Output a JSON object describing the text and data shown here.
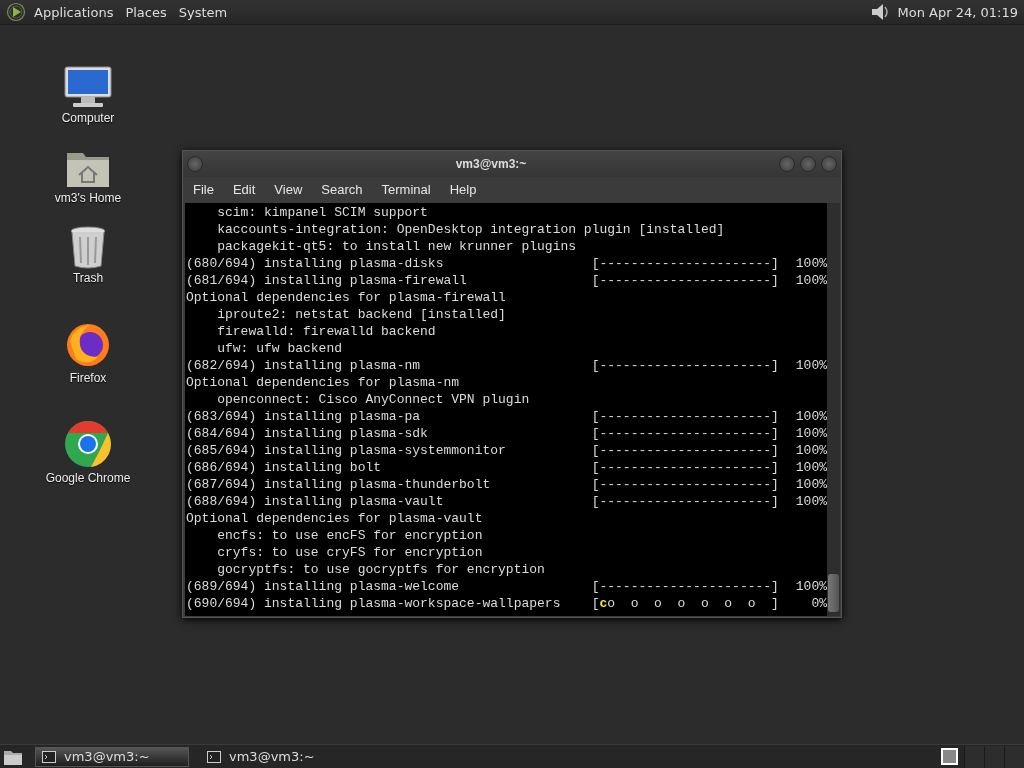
{
  "top_panel": {
    "menus": [
      "Applications",
      "Places",
      "System"
    ],
    "clock": "Mon Apr 24, 01:19"
  },
  "desktop_icons": [
    {
      "label": "Computer",
      "kind": "computer"
    },
    {
      "label": "vm3's Home",
      "kind": "home"
    },
    {
      "label": "Trash",
      "kind": "trash"
    },
    {
      "label": "Firefox",
      "kind": "firefox"
    },
    {
      "label": "Google Chrome",
      "kind": "chrome"
    }
  ],
  "terminal": {
    "title": "vm3@vm3:~",
    "menu": [
      "File",
      "Edit",
      "View",
      "Search",
      "Terminal",
      "Help"
    ],
    "lines": [
      {
        "kind": "text",
        "text": "    scim: kimpanel SCIM support"
      },
      {
        "kind": "text",
        "text": "    kaccounts-integration: OpenDesktop integration plugin [installed]"
      },
      {
        "kind": "text",
        "text": "    packagekit-qt5: to install new krunner plugins"
      },
      {
        "kind": "progress",
        "text": "(680/694) installing plasma-disks",
        "bar": [
          {
            "text": "[----------------------]",
            "highlight": false
          }
        ],
        "percent": "100%"
      },
      {
        "kind": "progress",
        "text": "(681/694) installing plasma-firewall",
        "bar": [
          {
            "text": "[----------------------]",
            "highlight": false
          }
        ],
        "percent": "100%"
      },
      {
        "kind": "text",
        "text": "Optional dependencies for plasma-firewall"
      },
      {
        "kind": "text",
        "text": "    iproute2: netstat backend [installed]"
      },
      {
        "kind": "text",
        "text": "    firewalld: firewalld backend"
      },
      {
        "kind": "text",
        "text": "    ufw: ufw backend"
      },
      {
        "kind": "progress",
        "text": "(682/694) installing plasma-nm",
        "bar": [
          {
            "text": "[----------------------]",
            "highlight": false
          }
        ],
        "percent": "100%"
      },
      {
        "kind": "text",
        "text": "Optional dependencies for plasma-nm"
      },
      {
        "kind": "text",
        "text": "    openconnect: Cisco AnyConnect VPN plugin"
      },
      {
        "kind": "progress",
        "text": "(683/694) installing plasma-pa",
        "bar": [
          {
            "text": "[----------------------]",
            "highlight": false
          }
        ],
        "percent": "100%"
      },
      {
        "kind": "progress",
        "text": "(684/694) installing plasma-sdk",
        "bar": [
          {
            "text": "[----------------------]",
            "highlight": false
          }
        ],
        "percent": "100%"
      },
      {
        "kind": "progress",
        "text": "(685/694) installing plasma-systemmonitor",
        "bar": [
          {
            "text": "[----------------------]",
            "highlight": false
          }
        ],
        "percent": "100%"
      },
      {
        "kind": "progress",
        "text": "(686/694) installing bolt",
        "bar": [
          {
            "text": "[----------------------]",
            "highlight": false
          }
        ],
        "percent": "100%"
      },
      {
        "kind": "progress",
        "text": "(687/694) installing plasma-thunderbolt",
        "bar": [
          {
            "text": "[----------------------]",
            "highlight": false
          }
        ],
        "percent": "100%"
      },
      {
        "kind": "progress",
        "text": "(688/694) installing plasma-vault",
        "bar": [
          {
            "text": "[----------------------]",
            "highlight": false
          }
        ],
        "percent": "100%"
      },
      {
        "kind": "text",
        "text": "Optional dependencies for plasma-vault"
      },
      {
        "kind": "text",
        "text": "    encfs: to use encFS for encryption"
      },
      {
        "kind": "text",
        "text": "    cryfs: to use cryFS for encryption"
      },
      {
        "kind": "text",
        "text": "    gocryptfs: to use gocryptfs for encryption"
      },
      {
        "kind": "progress",
        "text": "(689/694) installing plasma-welcome",
        "bar": [
          {
            "text": "[----------------------]",
            "highlight": false
          }
        ],
        "percent": "100%"
      },
      {
        "kind": "progress",
        "text": "(690/694) installing plasma-workspace-wallpapers",
        "bar": [
          {
            "text": "[",
            "highlight": false
          },
          {
            "text": "c",
            "highlight": true
          },
          {
            "text": "o  o  o  o  o  o  o  ]",
            "highlight": false
          }
        ],
        "percent": "0%"
      }
    ]
  },
  "taskbar": {
    "items": [
      {
        "label": "vm3@vm3:~",
        "selected": true
      },
      {
        "label": "vm3@vm3:~",
        "selected": false
      }
    ]
  }
}
